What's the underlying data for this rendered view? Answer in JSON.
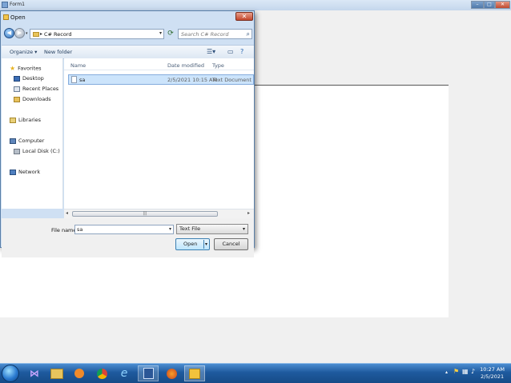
{
  "form": {
    "title": "Form1",
    "minimize": "–",
    "maximize": "□",
    "close": "✕"
  },
  "dialog": {
    "title": "Open",
    "close": "✕",
    "address": {
      "path": "C# Record"
    },
    "search": {
      "placeholder": "Search C# Record"
    },
    "toolbar": {
      "organize": "Organize ▾",
      "new_folder": "New folder"
    },
    "nav": [
      {
        "label": "Favorites",
        "icon": "star-icon"
      },
      {
        "label": "Desktop",
        "icon": "desktop-icon"
      },
      {
        "label": "Recent Places",
        "icon": "recent-places-icon"
      },
      {
        "label": "Downloads",
        "icon": "downloads-icon"
      },
      {
        "label": "Libraries",
        "icon": "libraries-icon"
      },
      {
        "label": "Computer",
        "icon": "computer-icon"
      },
      {
        "label": "Local Disk (C:)",
        "icon": "disk-icon"
      },
      {
        "label": "Network",
        "icon": "network-icon"
      }
    ],
    "columns": {
      "name": "Name",
      "date": "Date modified",
      "type": "Type"
    },
    "files": [
      {
        "name": "sa",
        "date": "2/5/2021 10:15 AM",
        "type": "Text Document"
      }
    ],
    "filename_label": "File name:",
    "filename_value": "sa",
    "filetype": "Text File",
    "open_label": "Open",
    "cancel_label": "Cancel"
  },
  "taskbar": {
    "time": "10:27 AM",
    "date": "2/5/2021"
  },
  "colors": {
    "selection": "#cce4fb",
    "taskbar": "#1e5a9e",
    "dialog_frame": "#cfe0f3"
  }
}
